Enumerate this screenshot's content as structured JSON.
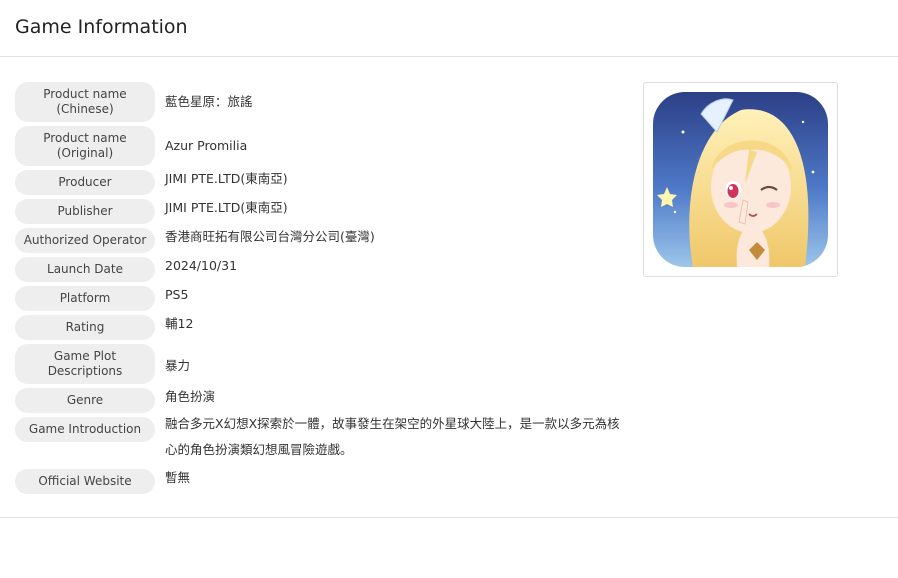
{
  "header": {
    "title": "Game Information"
  },
  "rows": [
    {
      "label": "Product name\n(Chinese)",
      "value": "藍色星原：旅謠"
    },
    {
      "label": "Product name\n(Original)",
      "value": "Azur Promilia"
    },
    {
      "label": "Producer",
      "value": "JIMI PTE.LTD(東南亞)"
    },
    {
      "label": "Publisher",
      "value": "JIMI PTE.LTD(東南亞)"
    },
    {
      "label": "Authorized Operator",
      "value": "香港商旺拓有限公司台灣分公司(臺灣)"
    },
    {
      "label": "Launch Date",
      "value": "2024/10/31"
    },
    {
      "label": "Platform",
      "value": "PS5"
    },
    {
      "label": "Rating",
      "value": "輔12"
    },
    {
      "label": "Game Plot\nDescriptions",
      "value": "暴力"
    },
    {
      "label": "Genre",
      "value": "角色扮演"
    },
    {
      "label": "Game Introduction",
      "value": "融合多元X幻想X探索於一體，故事發生在架空的外星球大陸上，是一款以多元為核\n心的角色扮演類幻想風冒險遊戲。"
    },
    {
      "label": "Official Website",
      "value": "暫無"
    }
  ],
  "colors": {
    "label_bg": "#eeeeee",
    "divider": "#e2e2e2",
    "text": "#333333"
  }
}
